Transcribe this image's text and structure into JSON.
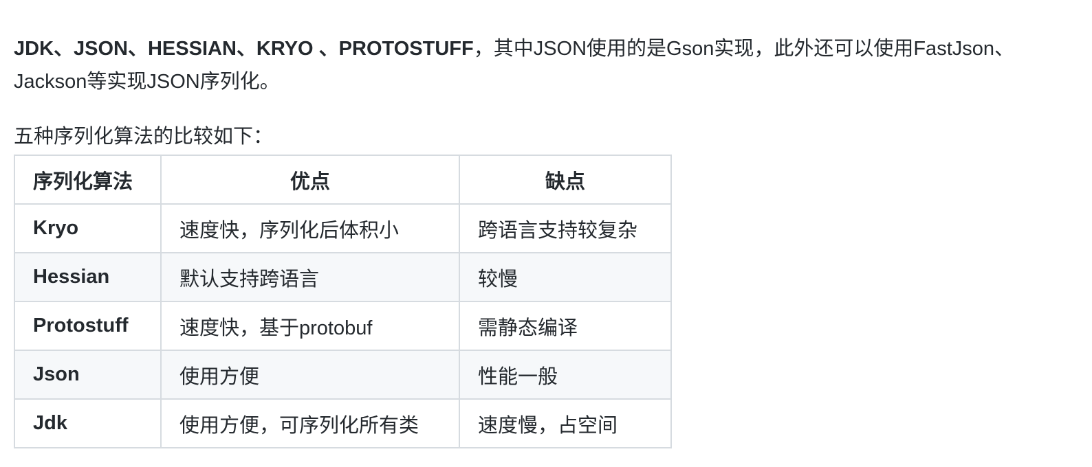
{
  "intro": {
    "line1": {
      "bold_formats": "JDK、JSON、HESSIAN、KRYO 、PROTOSTUFF",
      "rest": "，其中JSON使用的是Gson实现，此外还可以使用FastJson、"
    },
    "line2": "Jackson等实现JSON序列化。"
  },
  "comparison_intro": "五种序列化算法的比较如下：",
  "table": {
    "headers": [
      "序列化算法",
      "优点",
      "缺点"
    ],
    "rows": [
      {
        "name": "Kryo",
        "pros": "速度快，序列化后体积小",
        "cons": "跨语言支持较复杂"
      },
      {
        "name": "Hessian",
        "pros": "默认支持跨语言",
        "cons": "较慢"
      },
      {
        "name": "Protostuff",
        "pros": "速度快，基于protobuf",
        "cons": "需静态编译"
      },
      {
        "name": "Json",
        "pros": "使用方便",
        "cons": "性能一般"
      },
      {
        "name": "Jdk",
        "pros": "使用方便，可序列化所有类",
        "cons": "速度慢，占空间"
      }
    ]
  }
}
